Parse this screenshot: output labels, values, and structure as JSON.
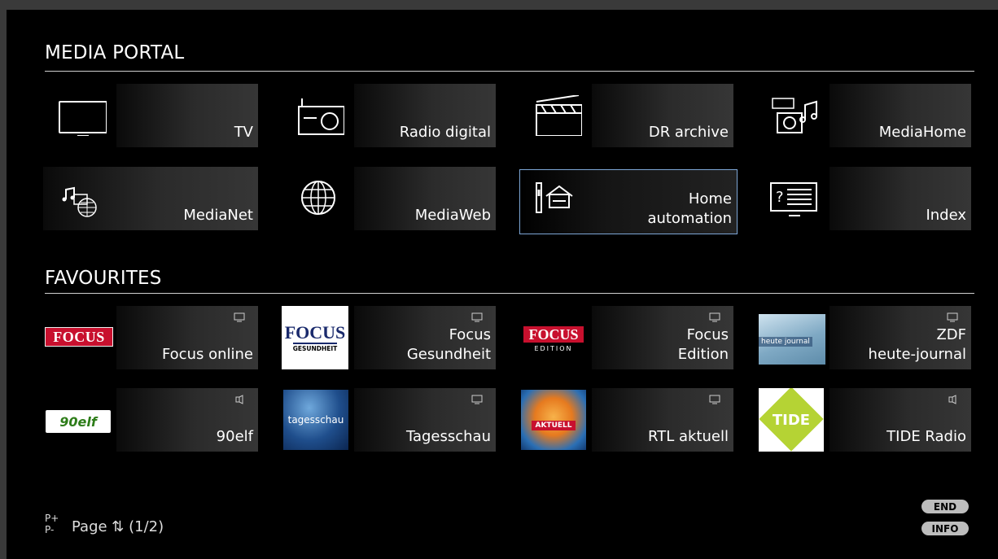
{
  "portal": {
    "title": "MEDIA PORTAL",
    "tiles": [
      {
        "label": "TV",
        "icon": "tv-icon"
      },
      {
        "label": "Radio digital",
        "icon": "radio-icon"
      },
      {
        "label": "DR archive",
        "icon": "clapperboard-icon"
      },
      {
        "label": "MediaHome",
        "icon": "media-home-icon"
      },
      {
        "label": "MediaNet",
        "icon": "media-net-icon"
      },
      {
        "label": "MediaWeb",
        "icon": "globe-icon"
      },
      {
        "label": "Home\nautomation",
        "icon": "home-automation-icon",
        "selected": true
      },
      {
        "label": "Index",
        "icon": "index-icon"
      }
    ]
  },
  "favourites": {
    "title": "FAVOURITES",
    "tiles": [
      {
        "label": "Focus online",
        "logo": "FOCUS",
        "type_icon": "tv-mini-icon"
      },
      {
        "label": "Focus\nGesundheit",
        "logo": "FOCUS",
        "logo_sub": "GESUNDHEIT",
        "type_icon": "tv-mini-icon"
      },
      {
        "label": "Focus\nEdition",
        "logo": "FOCUS",
        "logo_sub": "EDITION",
        "type_icon": "tv-mini-icon"
      },
      {
        "label": "ZDF\nheute-journal",
        "logo": "heute journal",
        "type_icon": "tv-mini-icon"
      },
      {
        "label": "90elf",
        "logo": "90elf",
        "type_icon": "radio-mini-icon"
      },
      {
        "label": "Tagesschau",
        "logo": "tagesschau",
        "type_icon": "tv-mini-icon"
      },
      {
        "label": "RTL aktuell",
        "logo": "AKTUELL",
        "type_icon": "tv-mini-icon"
      },
      {
        "label": "TIDE Radio",
        "logo": "TIDE",
        "type_icon": "radio-mini-icon"
      }
    ]
  },
  "footer": {
    "p_plus": "P+",
    "p_minus": "P-",
    "page_text": "Page ⇅ (1/2)",
    "end_label": "END",
    "info_label": "INFO"
  },
  "colors": {
    "background": "#000000",
    "selection_border": "#7da6d6",
    "focus_red": "#c8102e",
    "tide_green": "#b5d334"
  }
}
